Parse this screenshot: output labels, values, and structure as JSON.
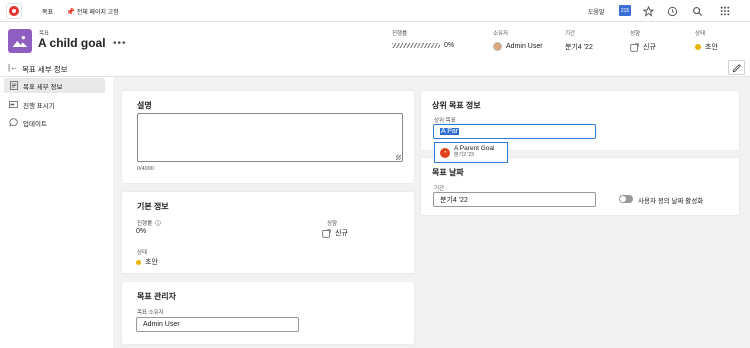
{
  "topbar": {
    "nav_goals": "목표",
    "nav_pin": "전체 페이지 고정",
    "help": "도움말",
    "badge": "215",
    "icons": [
      "star-icon",
      "clock-icon",
      "search-icon",
      "grid-icon"
    ]
  },
  "header": {
    "type_label": "목표",
    "title": "A child goal",
    "more": "•••",
    "progress": {
      "label": "진행률",
      "value": "0%",
      "fraction": 0
    },
    "owner": {
      "label": "소유자",
      "value": "Admin User"
    },
    "period": {
      "label": "기간",
      "value": "분기4 '22"
    },
    "result": {
      "label": "성향",
      "value": "신규"
    },
    "status": {
      "label": "상태",
      "value": "초안",
      "color": "#e8b400"
    }
  },
  "subbar": {
    "title": "목표 세부 정보"
  },
  "sidebar": {
    "items": [
      {
        "label": "목표 세부 정보",
        "icon": "document-icon",
        "active": true
      },
      {
        "label": "진행 표시기",
        "icon": "progress-icon",
        "active": false
      },
      {
        "label": "업데이트",
        "icon": "chat-icon",
        "active": false
      }
    ]
  },
  "description_card": {
    "title": "설명",
    "counter": "0/4000"
  },
  "basic_card": {
    "title": "기본 정보",
    "progress_label": "진행률",
    "progress_value": "0%",
    "result_label": "성향",
    "result_value": "신규",
    "status_label": "상태",
    "status_value": "초안"
  },
  "manager_card": {
    "title": "목표 관리자",
    "owner_label": "목표 소유자",
    "owner_value": "Admin User"
  },
  "parent_card": {
    "title": "상위 목표 정보",
    "field_label": "상위 목표",
    "input_value": "A Par",
    "suggestion_name": "A Parent Goal",
    "suggestion_period": "분기2 '23"
  },
  "dates_card": {
    "title": "목표 날짜",
    "period_label": "기간",
    "period_value": "분기4 '22",
    "toggle_label": "사용자 정의 날짜 활성화"
  },
  "colors": {
    "accent": "#2f7bd0",
    "avatar": "#8e5fc0",
    "brand": "#e5322d",
    "draft": "#e8b400"
  }
}
